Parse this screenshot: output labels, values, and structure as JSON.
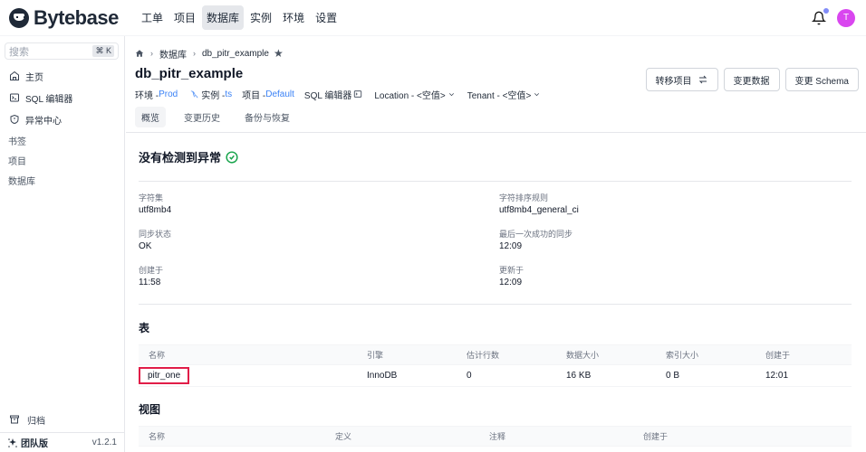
{
  "app": {
    "brand": "Bytebase"
  },
  "topnav": {
    "items": [
      {
        "label": "工单"
      },
      {
        "label": "项目"
      },
      {
        "label": "数据库",
        "active": true
      },
      {
        "label": "实例"
      },
      {
        "label": "环境"
      },
      {
        "label": "设置"
      }
    ],
    "avatar_initial": "T",
    "avatar_color": "#d946ef",
    "notification_dot_color": "#818cf8"
  },
  "sidebar": {
    "search_placeholder": "搜索",
    "search_shortcut": "⌘ K",
    "items": [
      {
        "label": "主页",
        "icon": "home-icon"
      },
      {
        "label": "SQL 编辑器",
        "icon": "terminal-icon"
      },
      {
        "label": "异常中心",
        "icon": "shield-icon"
      }
    ],
    "groups": [
      "书签",
      "项目",
      "数据库"
    ],
    "archive_label": "归档",
    "edition_label": "团队版",
    "version": "v1.2.1"
  },
  "header": {
    "breadcrumb": [
      "数据库",
      "db_pitr_example"
    ],
    "title": "db_pitr_example",
    "meta": {
      "env_label": "环境 - ",
      "env_value": "Prod",
      "instance_label": "实例 - ",
      "instance_value": "ts",
      "project_label": "项目 - ",
      "project_value": "Default",
      "sql_editor_label": "SQL 编辑器",
      "location_label": "Location - <空值>",
      "tenant_label": "Tenant - <空值>"
    },
    "buttons": {
      "transfer": "转移项目",
      "change_data": "变更数据",
      "change_schema": "变更 Schema"
    },
    "tabs": [
      "概览",
      "变更历史",
      "备份与恢复"
    ],
    "link_color": "#3b82f6"
  },
  "overview": {
    "anomaly_text": "没有检测到异常",
    "fields_left": [
      {
        "label": "字符集",
        "value": "utf8mb4"
      },
      {
        "label": "同步状态",
        "value": "OK"
      },
      {
        "label": "创建于",
        "value": "11:58"
      }
    ],
    "fields_right": [
      {
        "label": "字符排序规则",
        "value": "utf8mb4_general_ci"
      },
      {
        "label": "最后一次成功的同步",
        "value": "12:09"
      },
      {
        "label": "更新于",
        "value": "12:09"
      }
    ]
  },
  "tables_section": {
    "title": "表",
    "columns": [
      "名称",
      "引擎",
      "估计行数",
      "数据大小",
      "索引大小",
      "创建于"
    ],
    "rows": [
      [
        "pitr_one",
        "InnoDB",
        "0",
        "16 KB",
        "0 B",
        "12:01"
      ]
    ]
  },
  "views_section": {
    "title": "视图",
    "columns": [
      "名称",
      "定义",
      "注释",
      "创建于"
    ]
  }
}
